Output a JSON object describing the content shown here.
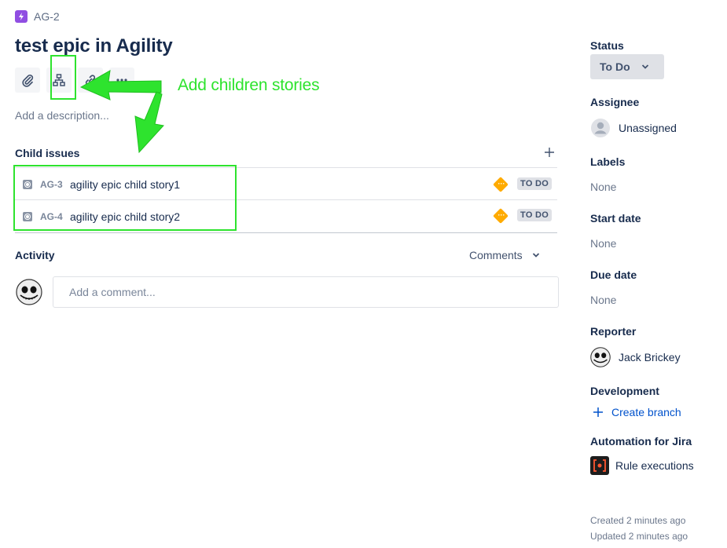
{
  "breadcrumb": {
    "issue_key": "AG-2"
  },
  "issue": {
    "title": "test epic in Agility",
    "description_placeholder": "Add a description..."
  },
  "toolbar": {
    "attach_icon": "paperclip-icon",
    "child_icon": "hierarchy-icon",
    "link_icon": "link-icon",
    "more_icon": "more-icon"
  },
  "annotation": {
    "text": "Add children stories",
    "color": "#2ee32e"
  },
  "child_issues": {
    "title": "Child issues",
    "add_icon": "plus-icon",
    "items": [
      {
        "key": "AG-3",
        "summary": "agility epic child story1",
        "status": "TO DO",
        "priority_icon": "medium-priority-icon"
      },
      {
        "key": "AG-4",
        "summary": "agility epic child story2",
        "status": "TO DO",
        "priority_icon": "medium-priority-icon"
      }
    ]
  },
  "activity": {
    "title": "Activity",
    "filter_label": "Comments",
    "comment_placeholder": "Add a comment..."
  },
  "sidebar": {
    "status_label": "Status",
    "status_value": "To Do",
    "assignee_label": "Assignee",
    "assignee_value": "Unassigned",
    "labels_label": "Labels",
    "labels_value": "None",
    "start_date_label": "Start date",
    "start_date_value": "None",
    "due_date_label": "Due date",
    "due_date_value": "None",
    "reporter_label": "Reporter",
    "reporter_value": "Jack Brickey",
    "development_label": "Development",
    "create_branch_label": "Create branch",
    "automation_label": "Automation for Jira",
    "rule_executions_label": "Rule executions",
    "created": "Created 2 minutes ago",
    "updated": "Updated 2 minutes ago"
  },
  "colors": {
    "accent": "#0052cc",
    "epic": "#904ee2",
    "priority_medium": "#ffab00"
  }
}
